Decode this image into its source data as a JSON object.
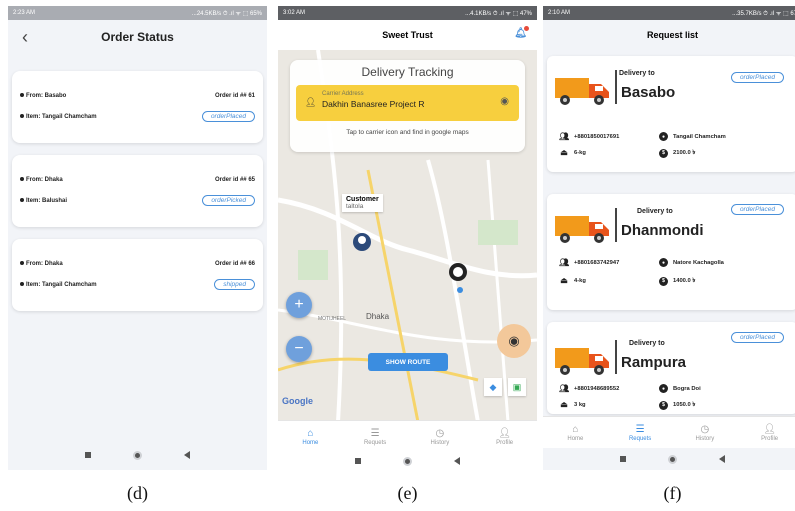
{
  "screen_d": {
    "status": {
      "time": "2:23 AM",
      "right": "...24.5KB/s ⏱ .ıl ᯤ ⬚ 65%"
    },
    "title": "Order Status",
    "orders": [
      {
        "from": "From: Basabo",
        "item": "Item: Tangail Chamcham",
        "order_id": "Order id ## 61",
        "status": "orderPlaced"
      },
      {
        "from": "From: Dhaka",
        "item": "Item: Balushai",
        "order_id": "Order id ## 65",
        "status": "orderPicked"
      },
      {
        "from": "From: Dhaka",
        "item": "Item: Tangail Chamcham",
        "order_id": "Order id ## 66",
        "status": "shipped"
      }
    ],
    "caption": "(d)"
  },
  "screen_e": {
    "status": {
      "time": "3:02 AM",
      "right": "...4.1KB/s ⏱ .ıl ᯤ ⬚ 47%"
    },
    "title": "Sweet Trust",
    "tracking_title": "Delivery Tracking",
    "carrier_label": "Carrier Address",
    "carrier_address": "Dakhin Banasree Project R",
    "tap_hint": "Tap to carrier icon and find in google maps",
    "customer_label": "Customer",
    "customer_place": "taltola",
    "show_route": "SHOW ROUTE",
    "map_labels": {
      "dhaka": "Dhaka",
      "google": "Google",
      "area": "MOTIJHEEL"
    },
    "tabs": [
      {
        "label": "Home",
        "icon": "home-icon",
        "active": true
      },
      {
        "label": "Requets",
        "icon": "list-icon",
        "active": false
      },
      {
        "label": "History",
        "icon": "history-icon",
        "active": false
      },
      {
        "label": "Profile",
        "icon": "profile-icon",
        "active": false
      }
    ],
    "caption": "(e)"
  },
  "screen_f": {
    "status": {
      "time": "2:10 AM",
      "right": "...35.7KB/s ⏱ .ıl ᯤ ⬚ 67"
    },
    "title": "Request list",
    "delivery_to_label": "Delivery to",
    "requests": [
      {
        "city": "Basabo",
        "status": "orderPlaced",
        "phone": "+8801850017691",
        "item": "Tangail Chamcham",
        "weight": "6-kg",
        "price": "2100.0 ৳"
      },
      {
        "city": "Dhanmondi",
        "status": "orderPlaced",
        "phone": "+8801683742947",
        "item": "Natore Kachagolla",
        "weight": "4-kg",
        "price": "1400.0 ৳"
      },
      {
        "city": "Rampura",
        "status": "orderPlaced",
        "phone": "+8801948689552",
        "item": "Bogra Doi",
        "weight": "3 kg",
        "price": "1050.0 ৳"
      }
    ],
    "tabs": [
      {
        "label": "Home",
        "icon": "home-icon",
        "active": false
      },
      {
        "label": "Requets",
        "icon": "list-icon",
        "active": true
      },
      {
        "label": "History",
        "icon": "history-icon",
        "active": false
      },
      {
        "label": "Profile",
        "icon": "profile-icon",
        "active": false
      }
    ],
    "caption": "(f)"
  },
  "colors": {
    "accent": "#3b8de0",
    "carrier_box": "#f7cf3e",
    "truck": "#f29a1b",
    "status_pill": "#4a90d9"
  }
}
